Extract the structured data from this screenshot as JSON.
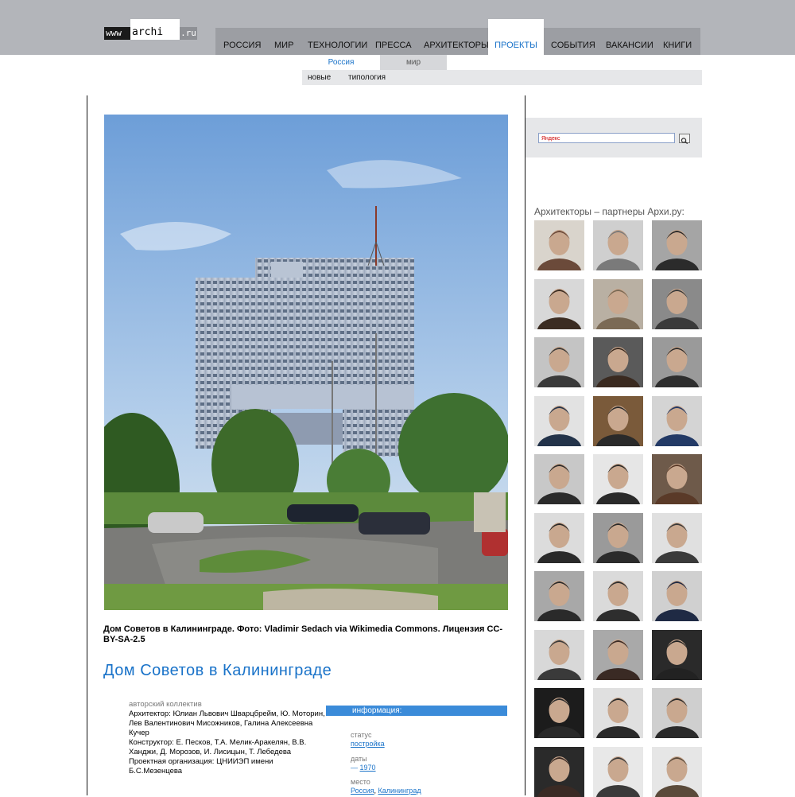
{
  "header": {
    "logo": {
      "www": "www",
      "main": "archi",
      "ru": ".ru"
    },
    "nav": [
      {
        "label": "РОССИЯ"
      },
      {
        "label": "МИР"
      },
      {
        "label": "ТЕХНОЛОГИИ"
      },
      {
        "label": "ПРЕССА"
      },
      {
        "label": "АРХИТЕКТОРЫ"
      },
      {
        "label": "ПРОЕКТЫ",
        "active": true
      },
      {
        "label": "СОБЫТИЯ"
      },
      {
        "label": "ВАКАНСИИ"
      },
      {
        "label": "КНИГИ"
      }
    ],
    "subnav": {
      "russia": "Россия",
      "world": "мир"
    },
    "subnav2": {
      "new": "новые",
      "typology": "типология"
    }
  },
  "article": {
    "caption": "Дом Советов в Калининграде. Фото: Vladimir Sedach via Wikimedia Commons. Лицензия CC-BY-SA-2.5",
    "title": "Дом Советов в Калининграде",
    "authors_label": "авторский коллектив",
    "authors_text": "Архитектор:  Юлиан Львович Шварцбрейм, Ю. Моторин, Лев Валентинович Мисожников, Галина Алексеевна Кучер",
    "constructor_text": "Конструктор:  Е. Песков, Т.А. Мелик-Аракелян, В.В. Ханджи, Д. Морозов, И. Лисицын, Т. Лебедева",
    "org_text": "Проектная организация: ЦНИИЭП имени Б.С.Мезенцева",
    "info": {
      "header": "информация:",
      "status_label": "статус",
      "status_value": "постройка",
      "dates_label": "даты",
      "dates_prefix": "— ",
      "dates_value": "1970",
      "place_label": "место",
      "place_country": "Россия",
      "place_sep": ", ",
      "place_city": "Калининград"
    }
  },
  "sidebar": {
    "search_placeholder": "Яндекс",
    "partners_title": "Архитекторы – партнеры Архи.ру:",
    "thumbs": [
      {
        "tone": "#6b4a3a",
        "bg": "#d9d4cc"
      },
      {
        "tone": "#7a7a7a",
        "bg": "#cfcfcf"
      },
      {
        "tone": "#2b2b2b",
        "bg": "#a5a5a5"
      },
      {
        "tone": "#3b2c22",
        "bg": "#d8d8d8"
      },
      {
        "tone": "#7b6a55",
        "bg": "#b9b0a3"
      },
      {
        "tone": "#3a3a3a",
        "bg": "#8a8a8a"
      },
      {
        "tone": "#3a3a3a",
        "bg": "#c4c4c4"
      },
      {
        "tone": "#3a2a20",
        "bg": "#5a5a5a"
      },
      {
        "tone": "#2e2e2e",
        "bg": "#9a9a9a"
      },
      {
        "tone": "#23334a",
        "bg": "#e2e2e2"
      },
      {
        "tone": "#2a2a2a",
        "bg": "#7a5a3a"
      },
      {
        "tone": "#233a66",
        "bg": "#d4d4d4"
      },
      {
        "tone": "#2b2b2b",
        "bg": "#c8c8c8"
      },
      {
        "tone": "#2a2a2a",
        "bg": "#e6e6e6"
      },
      {
        "tone": "#5a3a28",
        "bg": "#6e5a4a"
      },
      {
        "tone": "#2a2a2a",
        "bg": "#dcdcdc"
      },
      {
        "tone": "#2b2b2b",
        "bg": "#9a9a9a"
      },
      {
        "tone": "#3a3a3a",
        "bg": "#e0e0e0"
      },
      {
        "tone": "#2a2a2a",
        "bg": "#a8a8a8"
      },
      {
        "tone": "#2e2e2e",
        "bg": "#dadada"
      },
      {
        "tone": "#1f2a44",
        "bg": "#d0d0d0"
      },
      {
        "tone": "#3a3a3a",
        "bg": "#d8d8d8"
      },
      {
        "tone": "#3a2a24",
        "bg": "#a9a9a9"
      },
      {
        "tone": "#222",
        "bg": "#2a2a2a"
      },
      {
        "tone": "#2a2a2a",
        "bg": "#1c1c1c"
      },
      {
        "tone": "#2a2a2a",
        "bg": "#e0e0e0"
      },
      {
        "tone": "#2a2a2a",
        "bg": "#cfcfcf"
      },
      {
        "tone": "#3a2a24",
        "bg": "#2a2a2a"
      },
      {
        "tone": "#3a3a3a",
        "bg": "#e8e8e8"
      },
      {
        "tone": "#5a4a3a",
        "bg": "#e6e6e6"
      }
    ]
  }
}
